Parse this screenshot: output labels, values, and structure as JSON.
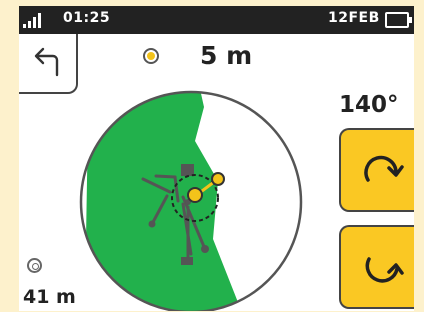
{
  "status_bar": {
    "time": "01:25",
    "date": "12FEB"
  },
  "gps": {
    "accuracy": "5 m"
  },
  "heading": "140°",
  "distance": "41 m",
  "icons": {
    "back": "back-arrow-icon",
    "rotate_cw": "rotate-clockwise-icon",
    "rotate_ccw": "rotate-counterclockwise-icon",
    "satellite": "satellite-icon",
    "target": "target-icon"
  },
  "colors": {
    "accent": "#fac823",
    "field": "#22b14c",
    "status_bar": "#222222",
    "frame": "#fdf1cc"
  }
}
